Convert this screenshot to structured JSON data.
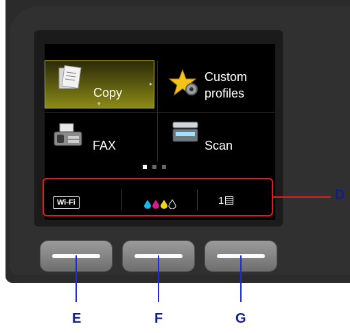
{
  "tiles": {
    "copy": {
      "label": "Copy",
      "icon": "copy-icon"
    },
    "custom_profiles": {
      "label_line1": "Custom",
      "label_line2": "profiles",
      "icon": "star-gear-icon"
    },
    "fax": {
      "label": "FAX",
      "icon": "fax-icon"
    },
    "scan": {
      "label": "Scan",
      "icon": "scanner-icon"
    }
  },
  "page_dots": {
    "count": 3,
    "active": 0
  },
  "status_bar": {
    "wifi": "Wi-Fi",
    "ink_colors": [
      "#19b6e8",
      "#d61b8c",
      "#f2d21a",
      "#ffffff"
    ],
    "queue_count": "1"
  },
  "callouts": {
    "d": "D",
    "e": "E",
    "f": "F",
    "g": "G"
  },
  "colors": {
    "highlight": "#e51a1a",
    "callout_text": "#0f1f8a",
    "leader": "#1a2dd6"
  }
}
